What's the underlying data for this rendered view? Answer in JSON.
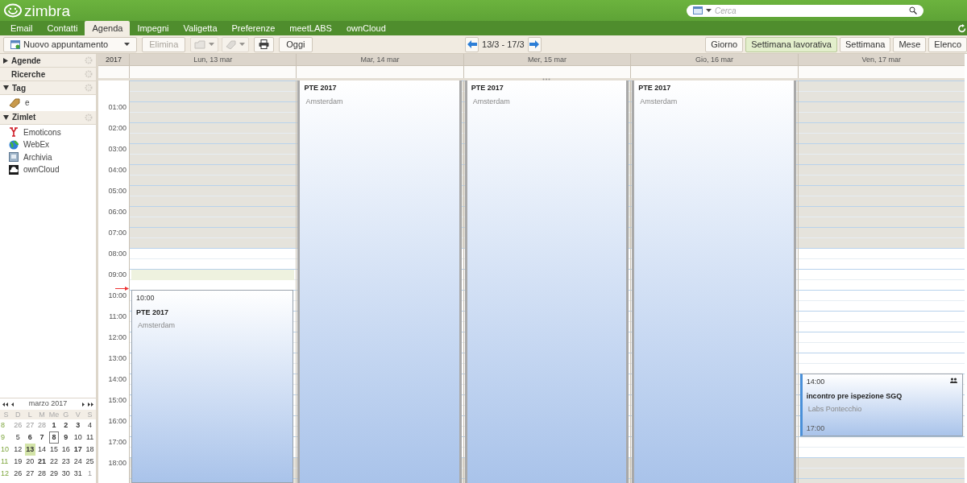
{
  "app": {
    "logo": "zimbra"
  },
  "search": {
    "placeholder": "Cerca"
  },
  "tabs": [
    {
      "label": "Email",
      "selected": false
    },
    {
      "label": "Contatti",
      "selected": false
    },
    {
      "label": "Agenda",
      "selected": true
    },
    {
      "label": "Impegni",
      "selected": false
    },
    {
      "label": "Valigetta",
      "selected": false
    },
    {
      "label": "Preferenze",
      "selected": false
    },
    {
      "label": "meetLABS",
      "selected": false
    },
    {
      "label": "ownCloud",
      "selected": false
    }
  ],
  "toolbar": {
    "new_button": "Nuovo appuntamento",
    "delete_button": {
      "label": "Elimina",
      "disabled": true
    },
    "tag_disabled": true,
    "today_button": "Oggi",
    "date_range": "13/3 - 17/3",
    "views": [
      {
        "label": "Giorno",
        "selected": false
      },
      {
        "label": "Settimana lavorativa",
        "selected": true
      },
      {
        "label": "Settimana",
        "selected": false
      },
      {
        "label": "Mese",
        "selected": false
      },
      {
        "label": "Elenco",
        "selected": false
      }
    ]
  },
  "sidebar": {
    "sections": [
      {
        "title": "Agende",
        "expanded": false
      },
      {
        "title": "Ricerche"
      },
      {
        "title": "Tag",
        "expanded": true,
        "items": [
          {
            "label": "e"
          }
        ]
      },
      {
        "title": "Zimlet",
        "expanded": true,
        "items": [
          {
            "label": "Emoticons"
          },
          {
            "label": "WebEx"
          },
          {
            "label": "Archivia"
          },
          {
            "label": "ownCloud"
          }
        ]
      }
    ]
  },
  "mini_calendar": {
    "title": "marzo 2017",
    "weekdays": [
      "S",
      "D",
      "L",
      "M",
      "Me",
      "G",
      "V",
      "S"
    ],
    "weeks": [
      {
        "week": "8",
        "days": [
          {
            "d": "26",
            "other_month": true,
            "bold": false,
            "today": false,
            "selected": false
          },
          {
            "d": "27",
            "other_month": true,
            "bold": false,
            "today": false,
            "selected": false
          },
          {
            "d": "28",
            "other_month": true,
            "bold": false,
            "today": false,
            "selected": false
          },
          {
            "d": "1",
            "other_month": false,
            "bold": true,
            "today": false,
            "selected": false
          },
          {
            "d": "2",
            "other_month": false,
            "bold": true,
            "today": false,
            "selected": false
          },
          {
            "d": "3",
            "other_month": false,
            "bold": true,
            "today": false,
            "selected": false
          },
          {
            "d": "4",
            "other_month": false,
            "bold": false,
            "today": false,
            "selected": false
          }
        ]
      },
      {
        "week": "9",
        "days": [
          {
            "d": "5",
            "other_month": false,
            "bold": false,
            "today": false,
            "selected": false
          },
          {
            "d": "6",
            "other_month": false,
            "bold": true,
            "today": false,
            "selected": false
          },
          {
            "d": "7",
            "other_month": false,
            "bold": true,
            "today": false,
            "selected": false
          },
          {
            "d": "8",
            "other_month": false,
            "bold": true,
            "today": true,
            "selected": false
          },
          {
            "d": "9",
            "other_month": false,
            "bold": true,
            "today": false,
            "selected": false
          },
          {
            "d": "10",
            "other_month": false,
            "bold": false,
            "today": false,
            "selected": false
          },
          {
            "d": "11",
            "other_month": false,
            "bold": false,
            "today": false,
            "selected": false
          }
        ]
      },
      {
        "week": "10",
        "days": [
          {
            "d": "12",
            "other_month": false,
            "bold": false,
            "today": false,
            "selected": false
          },
          {
            "d": "13",
            "other_month": false,
            "bold": true,
            "today": false,
            "selected": true
          },
          {
            "d": "14",
            "other_month": false,
            "bold": false,
            "today": false,
            "selected": false
          },
          {
            "d": "15",
            "other_month": false,
            "bold": false,
            "today": false,
            "selected": false
          },
          {
            "d": "16",
            "other_month": false,
            "bold": false,
            "today": false,
            "selected": false
          },
          {
            "d": "17",
            "other_month": false,
            "bold": true,
            "today": false,
            "selected": false
          },
          {
            "d": "18",
            "other_month": false,
            "bold": false,
            "today": false,
            "selected": false
          }
        ]
      },
      {
        "week": "11",
        "days": [
          {
            "d": "19",
            "other_month": false,
            "bold": false,
            "today": false,
            "selected": false
          },
          {
            "d": "20",
            "other_month": false,
            "bold": false,
            "today": false,
            "selected": false
          },
          {
            "d": "21",
            "other_month": false,
            "bold": true,
            "today": false,
            "selected": false
          },
          {
            "d": "22",
            "other_month": false,
            "bold": false,
            "today": false,
            "selected": false
          },
          {
            "d": "23",
            "other_month": false,
            "bold": false,
            "today": false,
            "selected": false
          },
          {
            "d": "24",
            "other_month": false,
            "bold": false,
            "today": false,
            "selected": false
          },
          {
            "d": "25",
            "other_month": false,
            "bold": false,
            "today": false,
            "selected": false
          }
        ]
      },
      {
        "week": "12",
        "days": [
          {
            "d": "26",
            "other_month": false,
            "bold": false,
            "today": false,
            "selected": false
          },
          {
            "d": "27",
            "other_month": false,
            "bold": false,
            "today": false,
            "selected": false
          },
          {
            "d": "28",
            "other_month": false,
            "bold": false,
            "today": false,
            "selected": false
          },
          {
            "d": "29",
            "other_month": false,
            "bold": false,
            "today": false,
            "selected": false
          },
          {
            "d": "30",
            "other_month": false,
            "bold": false,
            "today": false,
            "selected": false
          },
          {
            "d": "31",
            "other_month": false,
            "bold": false,
            "today": false,
            "selected": false
          },
          {
            "d": "1",
            "other_month": true,
            "bold": false,
            "today": false,
            "selected": false
          }
        ]
      }
    ]
  },
  "calendar": {
    "year": "2017",
    "now_marker": true,
    "hours": [
      "01:00",
      "02:00",
      "03:00",
      "04:00",
      "05:00",
      "06:00",
      "07:00",
      "08:00",
      "09:00",
      "10:00",
      "11:00",
      "12:00",
      "13:00",
      "14:00",
      "15:00",
      "16:00",
      "17:00",
      "18:00"
    ],
    "days": [
      {
        "label": "Lun, 13 mar",
        "slot_highlighted": true,
        "events": [
          {
            "kind": "timed",
            "time": "10:00",
            "title": "PTE 2017",
            "location": "Amsterdam",
            "has_attendees": false
          }
        ]
      },
      {
        "label": "Mar, 14 mar",
        "slot_highlighted": false,
        "events": [
          {
            "kind": "continuing",
            "title": "PTE 2017",
            "location": "Amsterdam",
            "has_attendees": false
          }
        ]
      },
      {
        "label": "Mer, 15 mar",
        "slot_highlighted": false,
        "events": [
          {
            "kind": "continuing",
            "title": "PTE 2017",
            "location": "Amsterdam",
            "has_attendees": false
          }
        ]
      },
      {
        "label": "Gio, 16 mar",
        "slot_highlighted": false,
        "events": [
          {
            "kind": "continuing",
            "title": "PTE 2017",
            "location": "Amsterdam",
            "has_attendees": false
          }
        ]
      },
      {
        "label": "Ven, 17 mar",
        "slot_highlighted": false,
        "events": [
          {
            "kind": "timed",
            "time": "14:00",
            "end_time": "17:00",
            "title": "incontro pre ispezione SGQ",
            "location": "Labs Pontecchio",
            "has_attendees": true
          }
        ]
      }
    ]
  }
}
